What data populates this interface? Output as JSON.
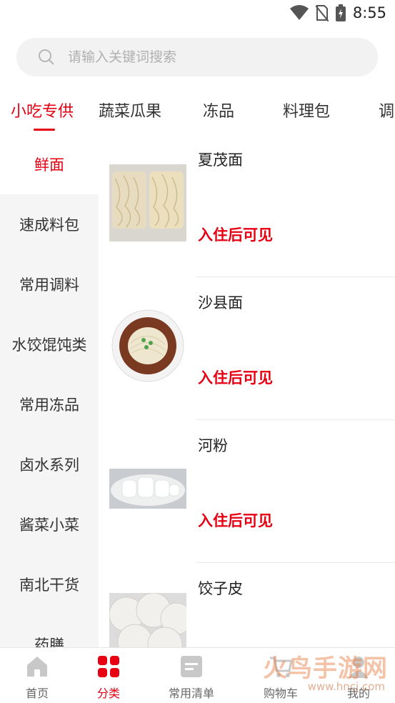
{
  "status_bar": {
    "time": "8:55"
  },
  "search": {
    "placeholder": "请输入关键词搜索"
  },
  "tabs": [
    {
      "label": "小吃专供",
      "active": true
    },
    {
      "label": "蔬菜瓜果"
    },
    {
      "label": "冻品"
    },
    {
      "label": "料理包"
    },
    {
      "label": "调"
    }
  ],
  "sidebar": {
    "items": [
      {
        "label": "鲜面",
        "active": true
      },
      {
        "label": "速成料包"
      },
      {
        "label": "常用调料"
      },
      {
        "label": "水饺馄饨类"
      },
      {
        "label": "常用冻品"
      },
      {
        "label": "卤水系列"
      },
      {
        "label": "酱菜小菜"
      },
      {
        "label": "南北干货"
      },
      {
        "label": "药膳"
      }
    ]
  },
  "products": [
    {
      "name": "夏茂面",
      "price_text": "入住后可见",
      "image": "noodle-bundles"
    },
    {
      "name": "沙县面",
      "price_text": "入住后可见",
      "image": "noodle-bowl"
    },
    {
      "name": "河粉",
      "price_text": "入住后可见",
      "image": "rice-noodles"
    },
    {
      "name": "饺子皮",
      "price_text": "",
      "image": "dumpling-wrappers"
    }
  ],
  "bottom_nav": [
    {
      "label": "首页",
      "icon": "home-icon"
    },
    {
      "label": "分类",
      "icon": "category-icon",
      "active": true
    },
    {
      "label": "常用清单",
      "icon": "list-icon"
    },
    {
      "label": "购物车",
      "icon": "cart-icon"
    },
    {
      "label": "我的",
      "icon": "user-icon"
    }
  ],
  "watermark": {
    "text": "火鸟手游网",
    "url": "www.hncj.com"
  },
  "colors": {
    "accent": "#e60012",
    "sidebar_bg": "#f5f5f5",
    "search_bg": "#f2f2f2"
  }
}
